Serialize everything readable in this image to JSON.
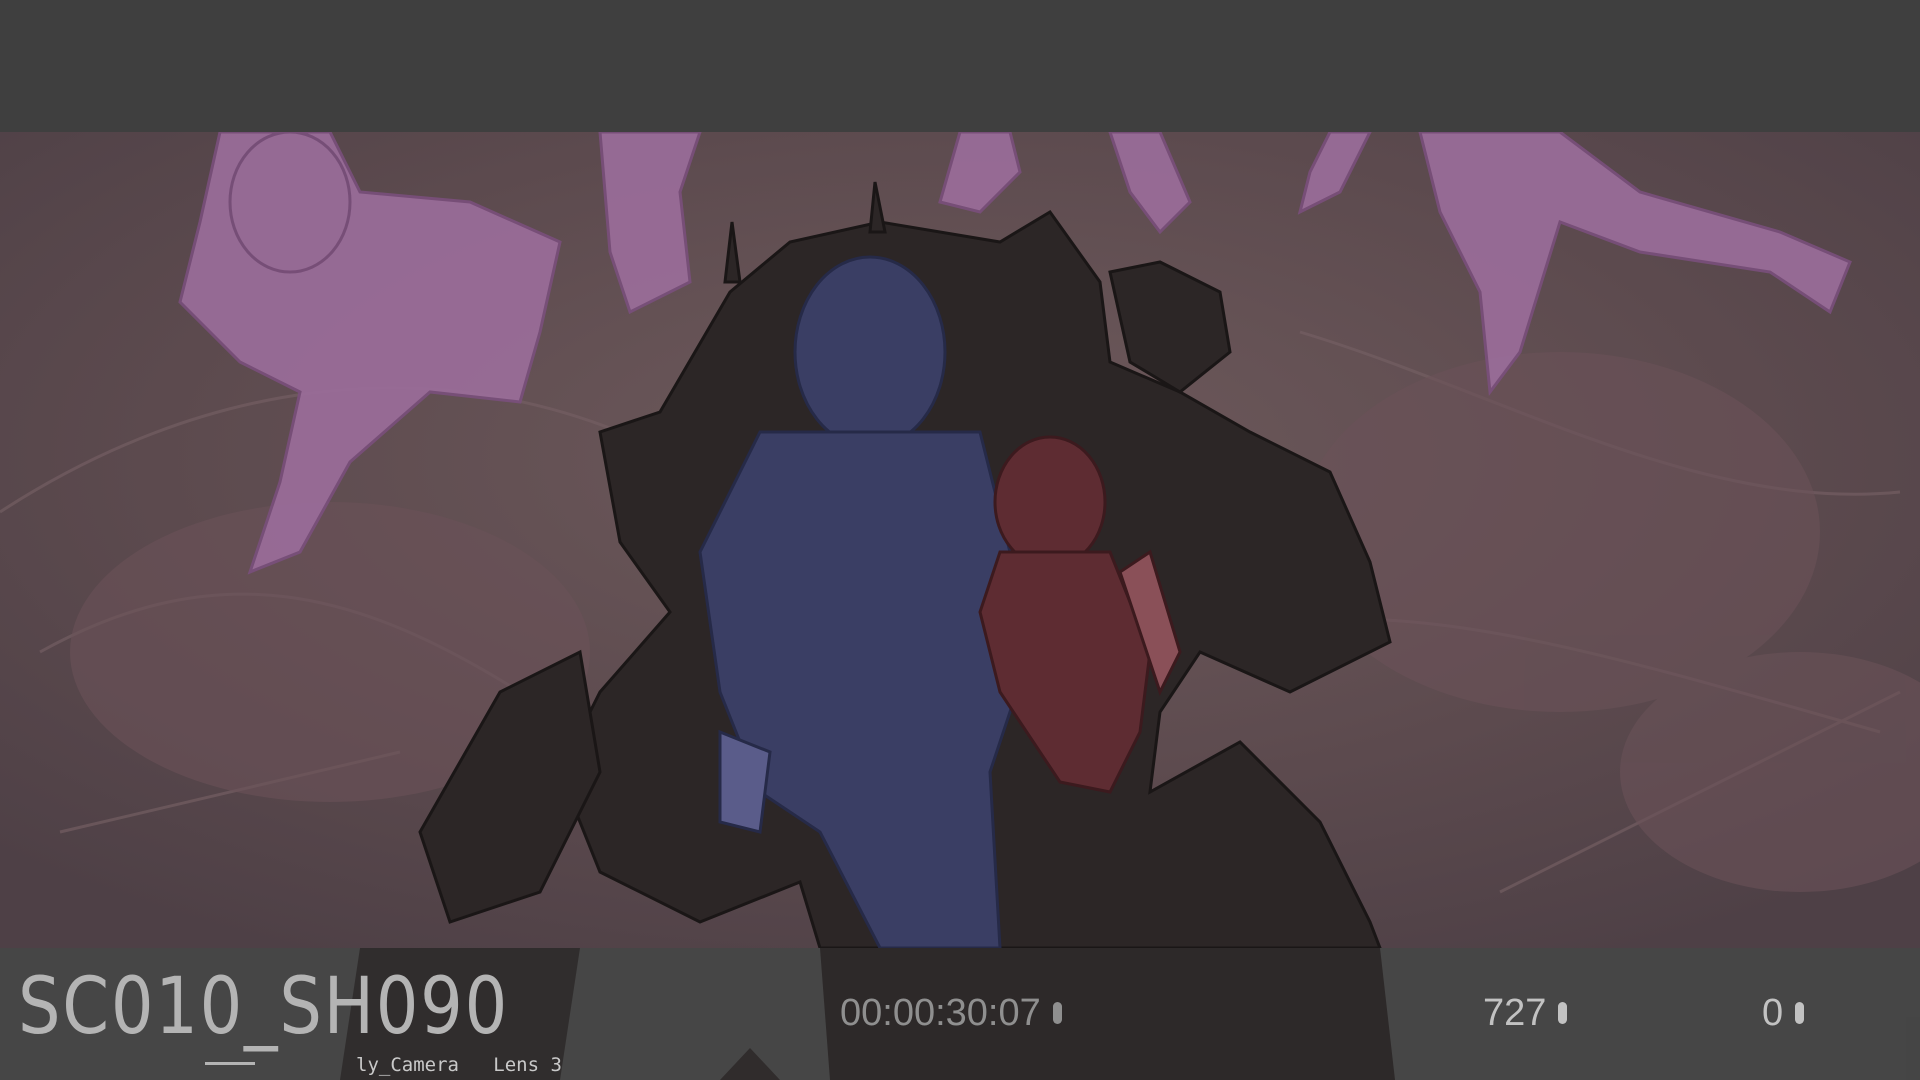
{
  "viewer": {
    "shot_label": "SC010_SH090",
    "timecode": "00:00:30:07",
    "frame_number": "727",
    "layer_number": "0",
    "camera_info": "ly_Camera   Lens 3"
  },
  "icons": {
    "timecode_knob": "slider-knob-icon",
    "frame_knob": "slider-knob-icon",
    "layer_knob": "slider-knob-icon"
  },
  "colors": {
    "letterbox": "#3f3f3f",
    "hud_bar": "#464646",
    "hud_text": "#c2c2c2",
    "hud_text_dim": "#8f8f8f",
    "sketch_pink": "#a878a8",
    "character_blue": "#3a3e62",
    "character_red": "#5a2a30",
    "robot_dark": "#2a2424"
  }
}
